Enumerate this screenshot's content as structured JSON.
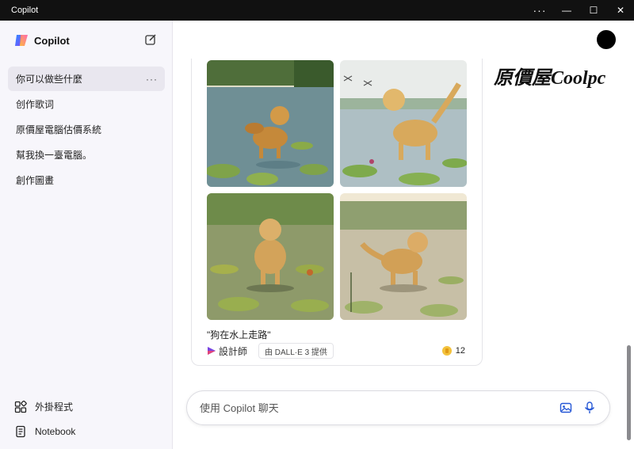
{
  "window": {
    "title": "Copilot",
    "controls": {
      "more": "···",
      "minimize": "—",
      "maximize": "☐",
      "close": "✕"
    }
  },
  "sidebar": {
    "brand": "Copilot",
    "conversations": [
      {
        "label": "你可以做些什麼",
        "active": true,
        "more": "···"
      },
      {
        "label": "创作歌词"
      },
      {
        "label": "原價屋電腦估價系統"
      },
      {
        "label": "幫我換一臺電腦。"
      },
      {
        "label": "創作圖畫"
      }
    ],
    "bottom": [
      {
        "label": "外掛程式",
        "icon": "plugins-icon"
      },
      {
        "label": "Notebook",
        "icon": "notebook-icon"
      }
    ]
  },
  "main": {
    "result": {
      "caption": "\"狗在水上走路\"",
      "designer_label": "設計師",
      "powered_by": "由 DALL·E 3 提供",
      "boosts": "12"
    },
    "watermark": "原價屋Coolpc",
    "chat": {
      "placeholder": "使用 Copilot 聊天"
    }
  },
  "colors": {
    "accent": "#2557d6",
    "sidebar_bg": "#f7f6fb",
    "boost": "#f3c23c"
  }
}
